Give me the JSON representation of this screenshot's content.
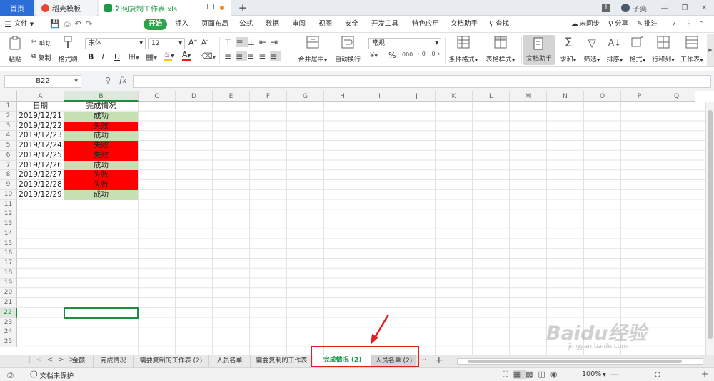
{
  "titlebar": {
    "home_tab": "首页",
    "docer_tab": "稻壳模板",
    "file_tab": "如何复制工作表.xls",
    "new_tab": "+",
    "badge": "1",
    "user": "子奕",
    "window_controls": [
      "minimize-icon",
      "restore-icon",
      "close-icon"
    ]
  },
  "menubar": {
    "file": "文件",
    "items": [
      "开始",
      "插入",
      "页面布局",
      "公式",
      "数据",
      "审阅",
      "视图",
      "安全",
      "开发工具",
      "特色应用",
      "文档助手"
    ],
    "search": "查找",
    "sync": "未同步",
    "share": "分享",
    "comment": "批注"
  },
  "ribbon": {
    "paste": "粘贴",
    "cut": "剪切",
    "copy": "复制",
    "format_painter": "格式刷",
    "font_name": "宋体",
    "font_size": "12",
    "merge_center": "合并居中",
    "wrap_text": "自动换行",
    "number_format": "常规",
    "conditional_format": "条件格式",
    "table_style": "表格样式",
    "doc_assistant": "文档助手",
    "sum": "求和",
    "filter": "筛选",
    "sort": "排序",
    "format": "格式",
    "row_col": "行和列",
    "worksheet": "工作表",
    "bold": "B",
    "italic": "I",
    "underline": "U",
    "font_color_letter": "A",
    "percent": "%",
    "thousands": "000",
    "fill_color": "#f5c518",
    "font_color": "#e02020"
  },
  "formula_bar": {
    "name_box": "B22",
    "fx": "fx"
  },
  "sheet": {
    "columns": [
      "A",
      "B",
      "C",
      "D",
      "E",
      "F",
      "G",
      "H",
      "I",
      "J",
      "K",
      "L",
      "M",
      "N",
      "O",
      "P",
      "Q"
    ],
    "rows": [
      "1",
      "2",
      "3",
      "4",
      "5",
      "6",
      "7",
      "8",
      "9",
      "10",
      "11",
      "12",
      "13",
      "14",
      "15",
      "16",
      "17",
      "18",
      "19",
      "20",
      "21",
      "22",
      "23",
      "24",
      "25"
    ],
    "header": {
      "date": "日期",
      "status": "完成情况"
    },
    "data": [
      {
        "date": "2019/12/21",
        "status": "成功"
      },
      {
        "date": "2019/12/22",
        "status": "失败"
      },
      {
        "date": "2019/12/23",
        "status": "成功"
      },
      {
        "date": "2019/12/24",
        "status": "失败"
      },
      {
        "date": "2019/12/25",
        "status": "失败"
      },
      {
        "date": "2019/12/26",
        "status": "成功"
      },
      {
        "date": "2019/12/27",
        "status": "失败"
      },
      {
        "date": "2019/12/28",
        "status": "失败"
      },
      {
        "date": "2019/12/29",
        "status": "成功"
      }
    ],
    "success_color": "#c6e0b4",
    "fail_color": "#ff0000",
    "selected_cell": "B22"
  },
  "sheet_tabs": {
    "nav": [
      "|<",
      "<",
      ">",
      ">|"
    ],
    "tabs": [
      "金额",
      "完成情况",
      "需要复制的工作表 (2)",
      "人员名单",
      "需要复制的工作表",
      "完成情况 (2)",
      "人员名单 (2)"
    ],
    "active": "完成情况 (2)",
    "more": "···",
    "add": "+"
  },
  "statusbar": {
    "protect": "文档未保护",
    "zoom": "100%"
  },
  "watermark": {
    "logo": "Baidu经验",
    "url": "jingyan.baidu.com"
  }
}
